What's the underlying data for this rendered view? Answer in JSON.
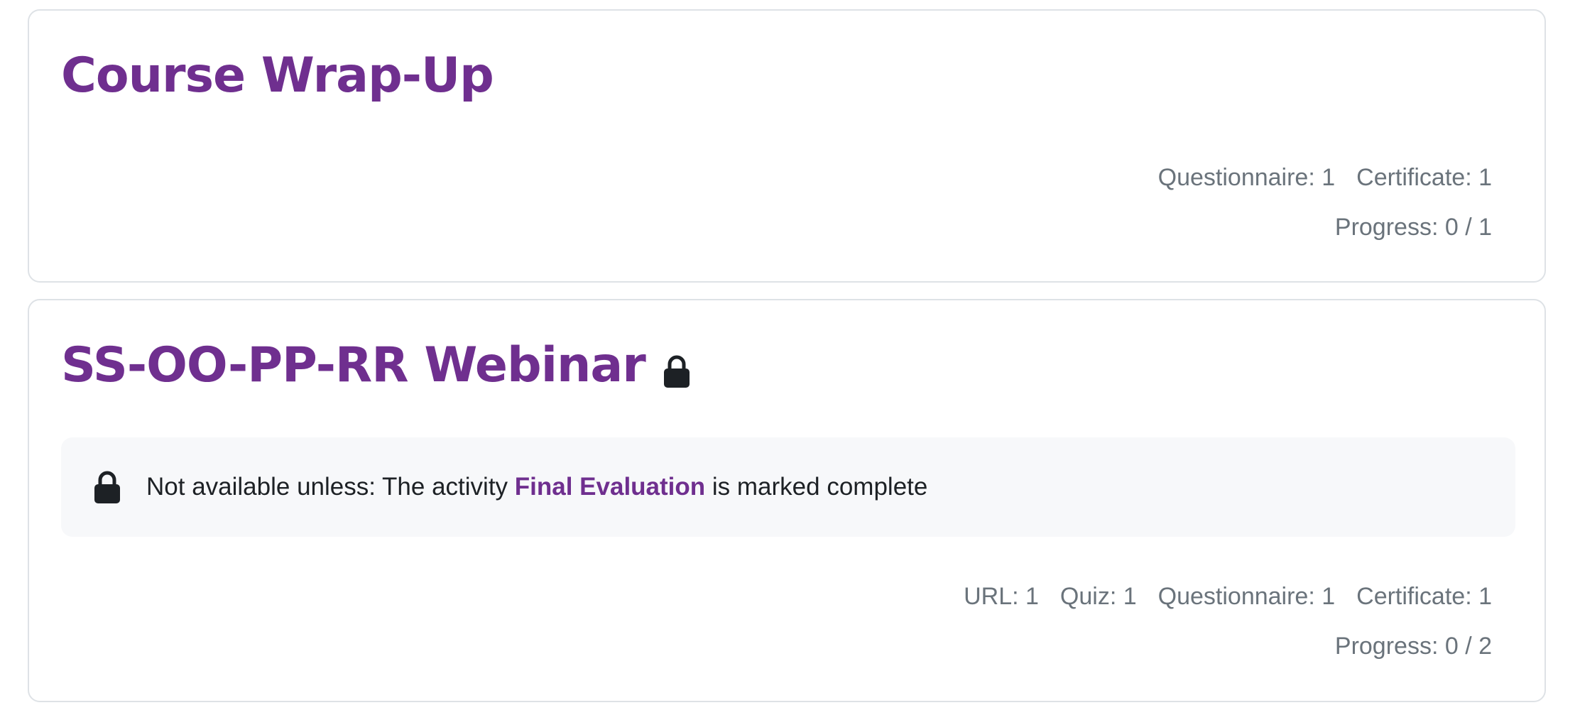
{
  "sections": [
    {
      "title": "Course Wrap-Up",
      "activity_counts": [
        "Questionnaire: 1",
        "Certificate: 1"
      ],
      "progress": "Progress: 0 / 1"
    },
    {
      "title": "SS-OO-PP-RR Webinar",
      "title_icon": "lock-icon",
      "restriction": {
        "icon": "lock-icon",
        "prefix": "Not available unless: The activity ",
        "link_text": "Final Evaluation",
        "suffix": " is marked complete"
      },
      "activity_counts": [
        "URL: 1",
        "Quiz: 1",
        "Questionnaire: 1",
        "Certificate: 1"
      ],
      "progress": "Progress: 0 / 2"
    }
  ],
  "colors": {
    "title": "#6f2f8f",
    "muted_text": "#6a737b",
    "body_text": "#1d2125",
    "card_border": "#dee2e6",
    "restriction_bg": "#f7f8fa",
    "icon": "#1d2125"
  }
}
